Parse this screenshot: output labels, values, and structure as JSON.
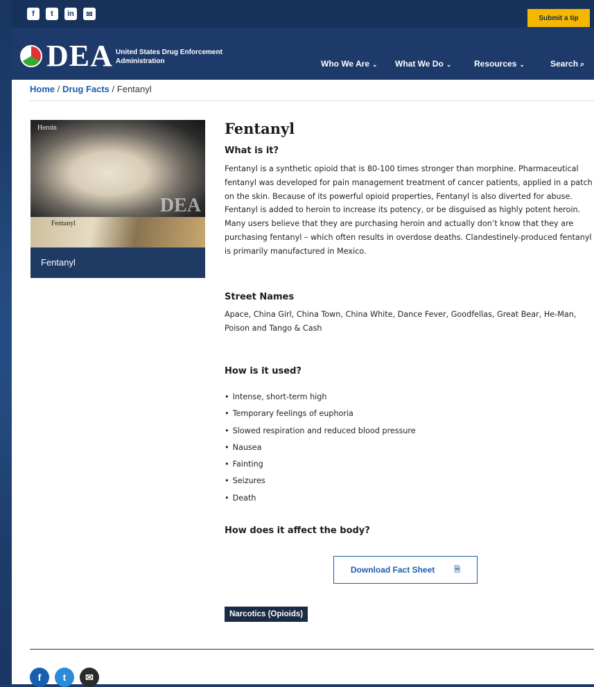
{
  "social_top": [
    {
      "icon": "facebook-icon",
      "glyph": "f"
    },
    {
      "icon": "twitter-icon",
      "glyph": "t"
    },
    {
      "icon": "linkedin-icon",
      "glyph": "in"
    },
    {
      "icon": "email-icon",
      "glyph": "✉"
    }
  ],
  "submit_tip": "Submit a tip",
  "header": {
    "logo": "DEA",
    "agency": "United States Drug Enforcement Administration",
    "nav": [
      {
        "label": "Who We Are"
      },
      {
        "label": "What We Do"
      },
      {
        "label": "Resources"
      },
      {
        "label": "Search"
      }
    ]
  },
  "breadcrumb": {
    "home": "Home",
    "parent": "Drug Facts",
    "current": "Fentanyl",
    "sep": "/"
  },
  "image": {
    "label_top": "Heroin",
    "label_bottom": "Fentanyl",
    "watermark": "DEA",
    "caption": "Fentanyl"
  },
  "article": {
    "title": "Fentanyl",
    "what_heading": "What is it?",
    "what_text": "Fentanyl is a synthetic opioid that is 80-100 times stronger than morphine. Pharmaceutical fentanyl was developed for pain management treatment of cancer patients, applied in a patch on the skin. Because of its powerful opioid properties, Fentanyl is also diverted for abuse. Fentanyl is added to heroin to increase its potency, or be disguised as highly potent heroin. Many users believe that they are purchasing heroin and actually don’t know that they are purchasing fentanyl – which often results in overdose deaths. Clandestinely-produced fentanyl is primarily manufactured in Mexico.",
    "street_heading": "Street Names",
    "street_text": "Apace, China Girl, China Town, China White, Dance Fever, Goodfellas, Great Bear, He-Man, Poison and Tango & Cash",
    "used_heading": "How is it used?",
    "used_items": [
      "Intense, short-term high",
      "Temporary feelings of euphoria",
      "Slowed respiration and reduced blood pressure",
      "Nausea",
      "Fainting",
      "Seizures",
      "Death"
    ],
    "affect_heading": "How does it affect the body?",
    "download_label": "Download Fact Sheet",
    "tag": "Narcotics (Opioids)"
  },
  "share": [
    {
      "icon": "facebook-icon",
      "glyph": "f",
      "color": "#1a5eb0"
    },
    {
      "icon": "twitter-icon",
      "glyph": "t",
      "color": "#2a8bd8"
    },
    {
      "icon": "email-icon",
      "glyph": "✉",
      "color": "#2b2b2b"
    }
  ]
}
